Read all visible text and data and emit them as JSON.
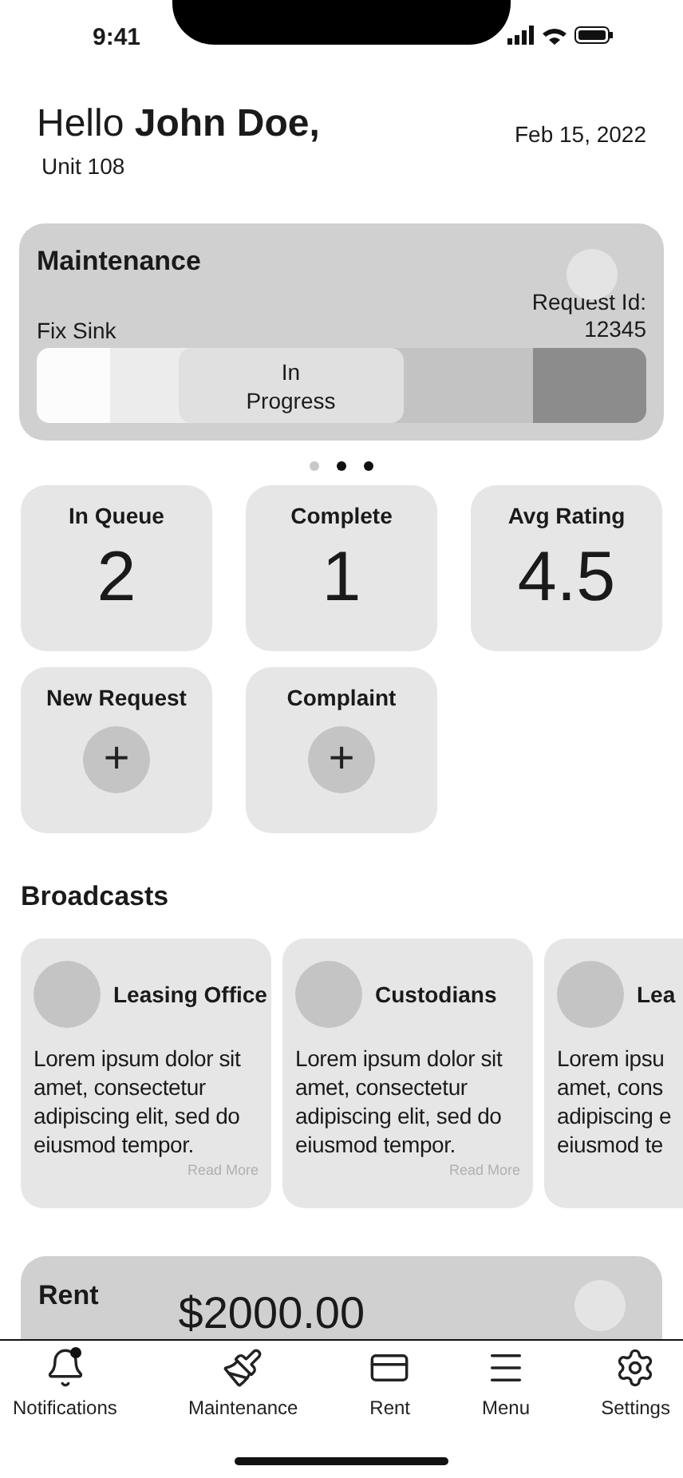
{
  "status_bar": {
    "time": "9:41"
  },
  "header": {
    "greeting": "Hello **John Doe,**",
    "unit": "Unit 108",
    "date": "Feb 15, 2022"
  },
  "maintenance": {
    "title": "Maintenance",
    "request": "Fix Sink",
    "request_id_label": "Request Id:",
    "request_id": "12345",
    "stages": [
      {
        "selected": false
      },
      {
        "selected": false
      },
      {
        "label": "In Progress",
        "selected": true
      },
      {
        "selected": false
      },
      {
        "selected": false
      }
    ]
  },
  "carousel_dots": [
    {
      "filled": false
    },
    {
      "filled": true
    },
    {
      "filled": true
    }
  ],
  "stats": [
    {
      "label": "In Queue",
      "value": "2"
    },
    {
      "label": "Complete",
      "value": "1"
    },
    {
      "label": "Avg Rating",
      "value": "4.5"
    }
  ],
  "actions": [
    {
      "label": "New Request",
      "icon": "+"
    },
    {
      "label": "Complaint",
      "icon": "+"
    }
  ],
  "broadcasts": {
    "title": "Broadcasts",
    "cards": [
      {
        "sender": "Leasing Office",
        "lines": [
          "Lorem ipsum dolor sit",
          "amet, consectetur",
          "adipiscing elit, sed do",
          "eiusmod tempor."
        ],
        "link": "Read More"
      },
      {
        "sender": "Custodians",
        "lines": [
          "Lorem ipsum dolor sit",
          "amet, consectetur",
          "adipiscing elit, sed do",
          "eiusmod tempor."
        ],
        "link": "Read More"
      },
      {
        "sender": "Lea",
        "lines": [
          "Lorem ipsu",
          "amet, cons",
          "adipiscing e",
          "eiusmod te"
        ]
      }
    ]
  },
  "rent": {
    "title": "Rent",
    "amount": "$2000.00"
  },
  "nav": [
    {
      "label": "Notifications",
      "badge": true
    },
    {
      "label": "Maintenance",
      "badge": false
    },
    {
      "label": "Rent",
      "badge": false
    },
    {
      "label": "Menu",
      "badge": false
    },
    {
      "label": "Settings",
      "badge": false
    }
  ]
}
